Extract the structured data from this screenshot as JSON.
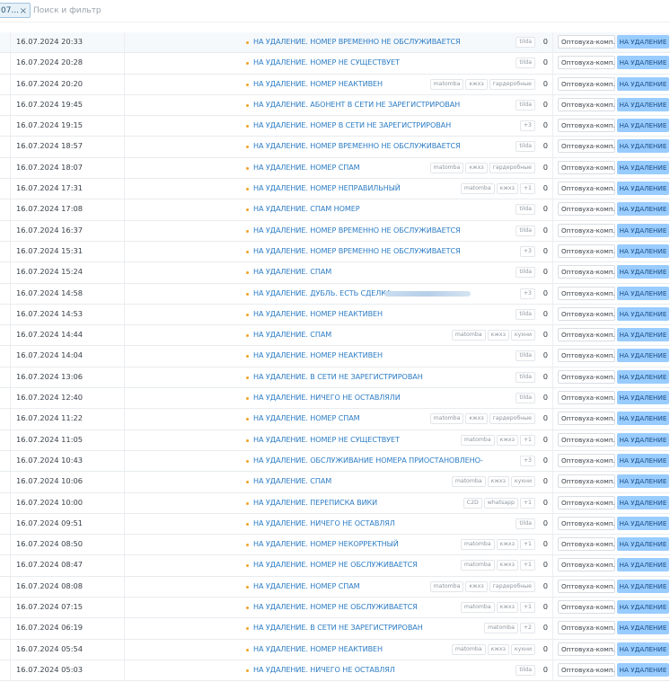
{
  "filter": {
    "chip_label": "07...",
    "chip_close": "×",
    "search_placeholder": "Поиск и фильтр"
  },
  "rows": [
    {
      "date": "16.07.2024 20:33",
      "title": "НА УДАЛЕНИЕ. НОМЕР ВРЕМЕННО НЕ ОБСЛУЖИВАЕТСЯ",
      "tags": [
        "tilda"
      ],
      "count": "0",
      "pipeline": "Оптовуха-комп...",
      "status": "НА УДАЛЕНИЕ"
    },
    {
      "date": "16.07.2024 20:28",
      "title": "НА УДАЛЕНИЕ. НОМЕР НЕ СУЩЕСТВУЕТ",
      "tags": [
        "tilda"
      ],
      "count": "0",
      "pipeline": "Оптовуха-комп...",
      "status": "НА УДАЛЕНИЕ"
    },
    {
      "date": "16.07.2024 20:20",
      "title": "НА УДАЛЕНИЕ. НОМЕР НЕАКТИВЕН",
      "tags": [
        "matomba",
        "кжхз",
        "гардеробные"
      ],
      "count": "0",
      "pipeline": "Оптовуха-комп...",
      "status": "НА УДАЛЕНИЕ"
    },
    {
      "date": "16.07.2024 19:45",
      "title": "НА УДАЛЕНИЕ. АБОНЕНТ В СЕТИ НЕ ЗАРЕГИСТРИРОВАН",
      "tags": [
        "tilda"
      ],
      "count": "0",
      "pipeline": "Оптовуха-комп...",
      "status": "НА УДАЛЕНИЕ"
    },
    {
      "date": "16.07.2024 19:15",
      "title": "НА УДАЛЕНИЕ. НОМЕР В СЕТИ НЕ ЗАРЕГИСТРИРОВАН",
      "tags": [
        "+3"
      ],
      "count": "0",
      "pipeline": "Оптовуха-комп...",
      "status": "НА УДАЛЕНИЕ"
    },
    {
      "date": "16.07.2024 18:57",
      "title": "НА УДАЛЕНИЕ. НОМЕР ВРЕМЕННО НЕ ОБСЛУЖИВАЕТСЯ",
      "tags": [
        "tilda"
      ],
      "count": "0",
      "pipeline": "Оптовуха-комп...",
      "status": "НА УДАЛЕНИЕ"
    },
    {
      "date": "16.07.2024 18:07",
      "title": "НА УДАЛЕНИЕ. НОМЕР СПАМ",
      "tags": [
        "matomba",
        "кжхз",
        "гардеробные"
      ],
      "count": "0",
      "pipeline": "Оптовуха-комп...",
      "status": "НА УДАЛЕНИЕ"
    },
    {
      "date": "16.07.2024 17:31",
      "title": "НА УДАЛЕНИЕ. НОМЕР НЕПРАВИЛЬНЫЙ",
      "tags": [
        "matomba",
        "кжхз",
        "+1"
      ],
      "count": "0",
      "pipeline": "Оптовуха-комп...",
      "status": "НА УДАЛЕНИЕ"
    },
    {
      "date": "16.07.2024 17:08",
      "title": "НА УДАЛЕНИЕ. СПАМ НОМЕР",
      "tags": [
        "tilda"
      ],
      "count": "0",
      "pipeline": "Оптовуха-комп...",
      "status": "НА УДАЛЕНИЕ"
    },
    {
      "date": "16.07.2024 16:37",
      "title": "НА УДАЛЕНИЕ. НОМЕР ВРЕМЕННО НЕ ОБСЛУЖИВАЕТСЯ",
      "tags": [
        "tilda"
      ],
      "count": "0",
      "pipeline": "Оптовуха-комп...",
      "status": "НА УДАЛЕНИЕ"
    },
    {
      "date": "16.07.2024 15:31",
      "title": "НА УДАЛЕНИЕ. НОМЕР ВРЕМЕННО НЕ ОБСЛУЖИВАЕТСЯ",
      "tags": [
        "+3"
      ],
      "count": "0",
      "pipeline": "Оптовуха-комп...",
      "status": "НА УДАЛЕНИЕ"
    },
    {
      "date": "16.07.2024 15:24",
      "title": "НА УДАЛЕНИЕ. СПАМ",
      "tags": [
        "tilda"
      ],
      "count": "0",
      "pipeline": "Оптовуха-комп...",
      "status": "НА УДАЛЕНИЕ"
    },
    {
      "date": "16.07.2024 14:58",
      "title": "НА УДАЛЕНИЕ. ДУБЛЬ. ЕСТЬ СДЕЛКА",
      "blurred": true,
      "tags": [
        "+3"
      ],
      "count": "0",
      "pipeline": "Оптовуха-комп...",
      "status": "НА УДАЛЕНИЕ"
    },
    {
      "date": "16.07.2024 14:53",
      "title": "НА УДАЛЕНИЕ. НОМЕР НЕАКТИВЕН",
      "tags": [
        "tilda"
      ],
      "count": "0",
      "pipeline": "Оптовуха-комп...",
      "status": "НА УДАЛЕНИЕ"
    },
    {
      "date": "16.07.2024 14:44",
      "title": "НА УДАЛЕНИЕ. СПАМ",
      "tags": [
        "matomba",
        "кжхз",
        "кухни"
      ],
      "count": "0",
      "pipeline": "Оптовуха-комп...",
      "status": "НА УДАЛЕНИЕ"
    },
    {
      "date": "16.07.2024 14:04",
      "title": "НА УДАЛЕНИЕ. НОМЕР НЕАКТИВЕН",
      "tags": [
        "tilda"
      ],
      "count": "0",
      "pipeline": "Оптовуха-комп...",
      "status": "НА УДАЛЕНИЕ"
    },
    {
      "date": "16.07.2024 13:06",
      "title": "НА УДАЛЕНИЕ. В СЕТИ НЕ ЗАРЕГИСТРИРОВАН",
      "tags": [
        "tilda"
      ],
      "count": "0",
      "pipeline": "Оптовуха-комп...",
      "status": "НА УДАЛЕНИЕ"
    },
    {
      "date": "16.07.2024 12:40",
      "title": "НА УДАЛЕНИЕ. НИЧЕГО НЕ ОСТАВЛЯЛИ",
      "tags": [
        "tilda"
      ],
      "count": "0",
      "pipeline": "Оптовуха-комп...",
      "status": "НА УДАЛЕНИЕ"
    },
    {
      "date": "16.07.2024 11:22",
      "title": "НА УДАЛЕНИЕ. НОМЕР СПАМ",
      "tags": [
        "matomba",
        "кжхз",
        "гардеробные"
      ],
      "count": "0",
      "pipeline": "Оптовуха-комп...",
      "status": "НА УДАЛЕНИЕ"
    },
    {
      "date": "16.07.2024 11:05",
      "title": "НА УДАЛЕНИЕ. НОМЕР НЕ СУЩЕСТВУЕТ",
      "tags": [
        "matomba",
        "кжхз",
        "+1"
      ],
      "count": "0",
      "pipeline": "Оптовуха-комп...",
      "status": "НА УДАЛЕНИЕ"
    },
    {
      "date": "16.07.2024 10:43",
      "title": "НА УДАЛЕНИЕ. ОБСЛУЖИВАНИЕ НОМЕРА ПРИОСТАНОВЛЕНО-",
      "tags": [
        "+3"
      ],
      "count": "0",
      "pipeline": "Оптовуха-комп...",
      "status": "НА УДАЛЕНИЕ"
    },
    {
      "date": "16.07.2024 10:06",
      "title": "НА УДАЛЕНИЕ. СПАМ",
      "tags": [
        "matomba",
        "кжхз",
        "кухни"
      ],
      "count": "0",
      "pipeline": "Оптовуха-комп...",
      "status": "НА УДАЛЕНИЕ"
    },
    {
      "date": "16.07.2024 10:00",
      "title": "НА УДАЛЕНИЕ. ПЕРЕПИСКА ВИКИ",
      "tags": [
        "C2D",
        "whatsapp",
        "+1"
      ],
      "count": "0",
      "pipeline": "Оптовуха-комп...",
      "status": "НА УДАЛЕНИЕ"
    },
    {
      "date": "16.07.2024 09:51",
      "title": "НА УДАЛЕНИЕ. НИЧЕГО НЕ ОСТАВЛЯЛ",
      "tags": [
        "tilda"
      ],
      "count": "0",
      "pipeline": "Оптовуха-комп...",
      "status": "НА УДАЛЕНИЕ"
    },
    {
      "date": "16.07.2024 08:50",
      "title": "НА УДАЛЕНИЕ. НОМЕР НЕКОРРЕКТНЫЙ",
      "tags": [
        "matomba",
        "кжхз",
        "+1"
      ],
      "count": "0",
      "pipeline": "Оптовуха-комп...",
      "status": "НА УДАЛЕНИЕ"
    },
    {
      "date": "16.07.2024 08:47",
      "title": "НА УДАЛЕНИЕ. НОМЕР НЕ ОБСЛУЖИВАЕТСЯ",
      "tags": [
        "matomba",
        "кжхз",
        "+1"
      ],
      "count": "0",
      "pipeline": "Оптовуха-комп...",
      "status": "НА УДАЛЕНИЕ"
    },
    {
      "date": "16.07.2024 08:08",
      "title": "НА УДАЛЕНИЕ. НОМЕР СПАМ",
      "tags": [
        "matomba",
        "кжхз",
        "гардеробные"
      ],
      "count": "0",
      "pipeline": "Оптовуха-комп...",
      "status": "НА УДАЛЕНИЕ"
    },
    {
      "date": "16.07.2024 07:15",
      "title": "НА УДАЛЕНИЕ. НОМЕР НЕ ОБСЛУЖИВАЕТСЯ",
      "tags": [
        "matomba",
        "кжхз",
        "+1"
      ],
      "count": "0",
      "pipeline": "Оптовуха-комп...",
      "status": "НА УДАЛЕНИЕ"
    },
    {
      "date": "16.07.2024 06:19",
      "title": "НА УДАЛЕНИЕ. В СЕТИ НЕ ЗАРЕГИСТРИРОВАН",
      "tags": [
        "matomba",
        "+2"
      ],
      "count": "0",
      "pipeline": "Оптовуха-комп...",
      "status": "НА УДАЛЕНИЕ"
    },
    {
      "date": "16.07.2024 05:54",
      "title": "НА УДАЛЕНИЕ. НОМЕР НЕАКТИВЕН",
      "tags": [
        "matomba",
        "кжхз",
        "кухни"
      ],
      "count": "0",
      "pipeline": "Оптовуха-комп...",
      "status": "НА УДАЛЕНИЕ"
    },
    {
      "date": "16.07.2024 05:03",
      "title": "НА УДАЛЕНИЕ. НИЧЕГО НЕ ОСТАВЛЯЛ",
      "tags": [
        "tilda"
      ],
      "count": "0",
      "pipeline": "Оптовуха-комп...",
      "status": "НА УДАЛЕНИЕ"
    }
  ]
}
